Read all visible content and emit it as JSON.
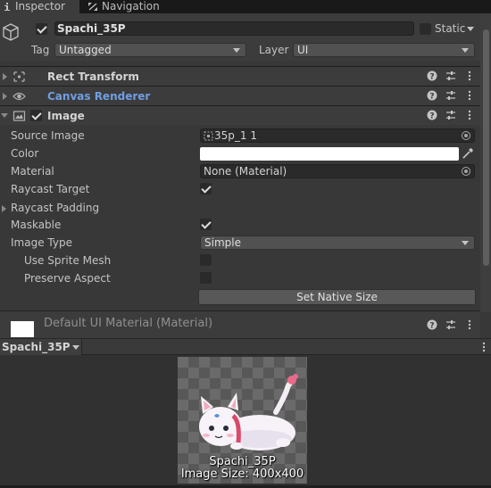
{
  "tabs": [
    {
      "label": "Inspector",
      "icon": "info-icon"
    },
    {
      "label": "Navigation",
      "icon": "navigation-icon"
    }
  ],
  "gameobject": {
    "name": "Spachi_35P",
    "active": true,
    "static_label": "Static",
    "tag_label": "Tag",
    "tag_value": "Untagged",
    "layer_label": "Layer",
    "layer_value": "UI"
  },
  "components": [
    {
      "title": "Rect Transform",
      "icon": "rect-transform-icon",
      "expanded": false
    },
    {
      "title": "Canvas Renderer",
      "icon": "eye-icon",
      "expanded": false
    },
    {
      "title": "Image",
      "icon": "image-icon",
      "expanded": true,
      "enabled": true
    }
  ],
  "image_props": {
    "source_image_label": "Source Image",
    "source_image_value": "35p_1 1",
    "color_label": "Color",
    "color_value": "#ffffff",
    "material_label": "Material",
    "material_value": "None (Material)",
    "raycast_target_label": "Raycast Target",
    "raycast_target": true,
    "raycast_padding_label": "Raycast Padding",
    "maskable_label": "Maskable",
    "maskable": true,
    "image_type_label": "Image Type",
    "image_type_value": "Simple",
    "use_sprite_mesh_label": "Use Sprite Mesh",
    "use_sprite_mesh": false,
    "preserve_aspect_label": "Preserve Aspect",
    "preserve_aspect": false,
    "set_native_size_label": "Set Native Size"
  },
  "material_section": {
    "title": "Default UI Material (Material)"
  },
  "preview": {
    "dropdown_label": "Spachi_35P",
    "name": "Spachi_35P",
    "size_text": "Image Size: 400x400"
  },
  "colors": {
    "accent_blue": "#6f9fe3",
    "panel_bg": "#383838",
    "header_bg": "#3c3c3c"
  }
}
